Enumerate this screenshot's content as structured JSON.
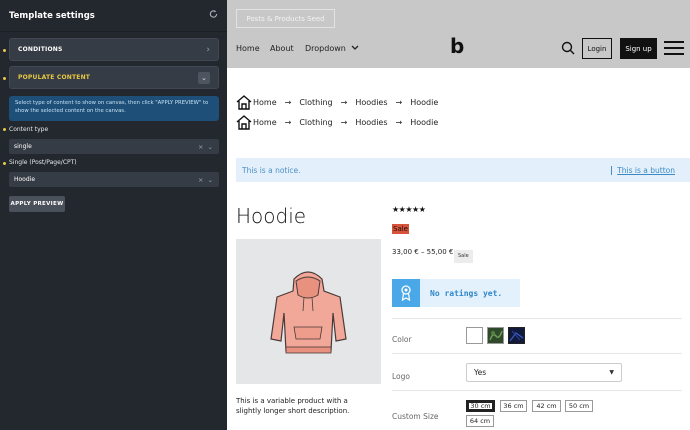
{
  "sidebar": {
    "title": "Template settings",
    "sections": [
      {
        "label": "CONDITIONS"
      },
      {
        "label": "POPULATE CONTENT"
      }
    ],
    "info": "Select type of content to show on canvas, then click \"APPLY PREVIEW\" to show the selected content on the canvas.",
    "content_type_label": "Content type",
    "content_type_value": "single",
    "single_label": "Single (Post/Page/CPT)",
    "single_value": "Hoodie",
    "apply_label": "APPLY PREVIEW",
    "select_controls": "× ⌄",
    "accent": "#e8c843"
  },
  "header": {
    "top_button": "Posts & Products Seed",
    "nav": {
      "home": "Home",
      "about": "About",
      "dropdown": "Dropdown"
    },
    "logo": "b",
    "login": "Login",
    "signup": "Sign up"
  },
  "breadcrumbs": [
    [
      "Home",
      "Clothing",
      "Hoodies",
      "Hoodie"
    ],
    [
      "Home",
      "Clothing",
      "Hoodies",
      "Hoodie"
    ]
  ],
  "notice": {
    "text": "This is a notice.",
    "button": "This is a button"
  },
  "product": {
    "title": "Hoodie",
    "rating_stars": "★★★★★",
    "sale_highlight": "Sale",
    "price": "33,00 € – 55,00 €",
    "sale_badge": "Sale",
    "no_ratings": "No ratings yet.",
    "short_description": "This is a variable product with a slightly longer short description.",
    "attributes": {
      "color_label": "Color",
      "logo_label": "Logo",
      "logo_value": "Yes",
      "size_label": "Custom Size",
      "sizes": [
        "30 cm",
        "36 cm",
        "42 cm",
        "50 cm",
        "64 cm"
      ],
      "selected_size": "30 cm"
    }
  }
}
